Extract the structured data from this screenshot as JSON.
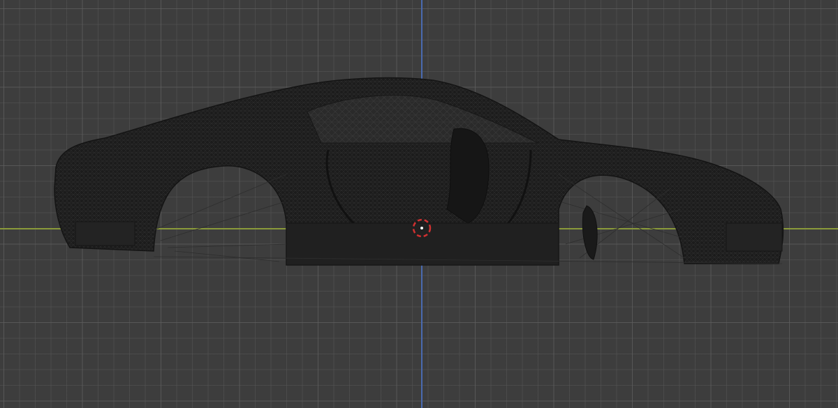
{
  "app": "3D viewport",
  "view": {
    "mode": "wireframe",
    "orientation": "side"
  },
  "colors": {
    "background": "#3d3d3d",
    "grid_line": "#555555",
    "x_axis": "#8a9a3a",
    "z_axis": "#4a6ab0",
    "mesh": "#1b1b1b",
    "mesh_edge": "#2a2a2a",
    "cursor_outer": "#e0e0e0",
    "cursor_accent": "#d03030"
  },
  "icons": {
    "cursor": "3d-cursor-icon"
  }
}
